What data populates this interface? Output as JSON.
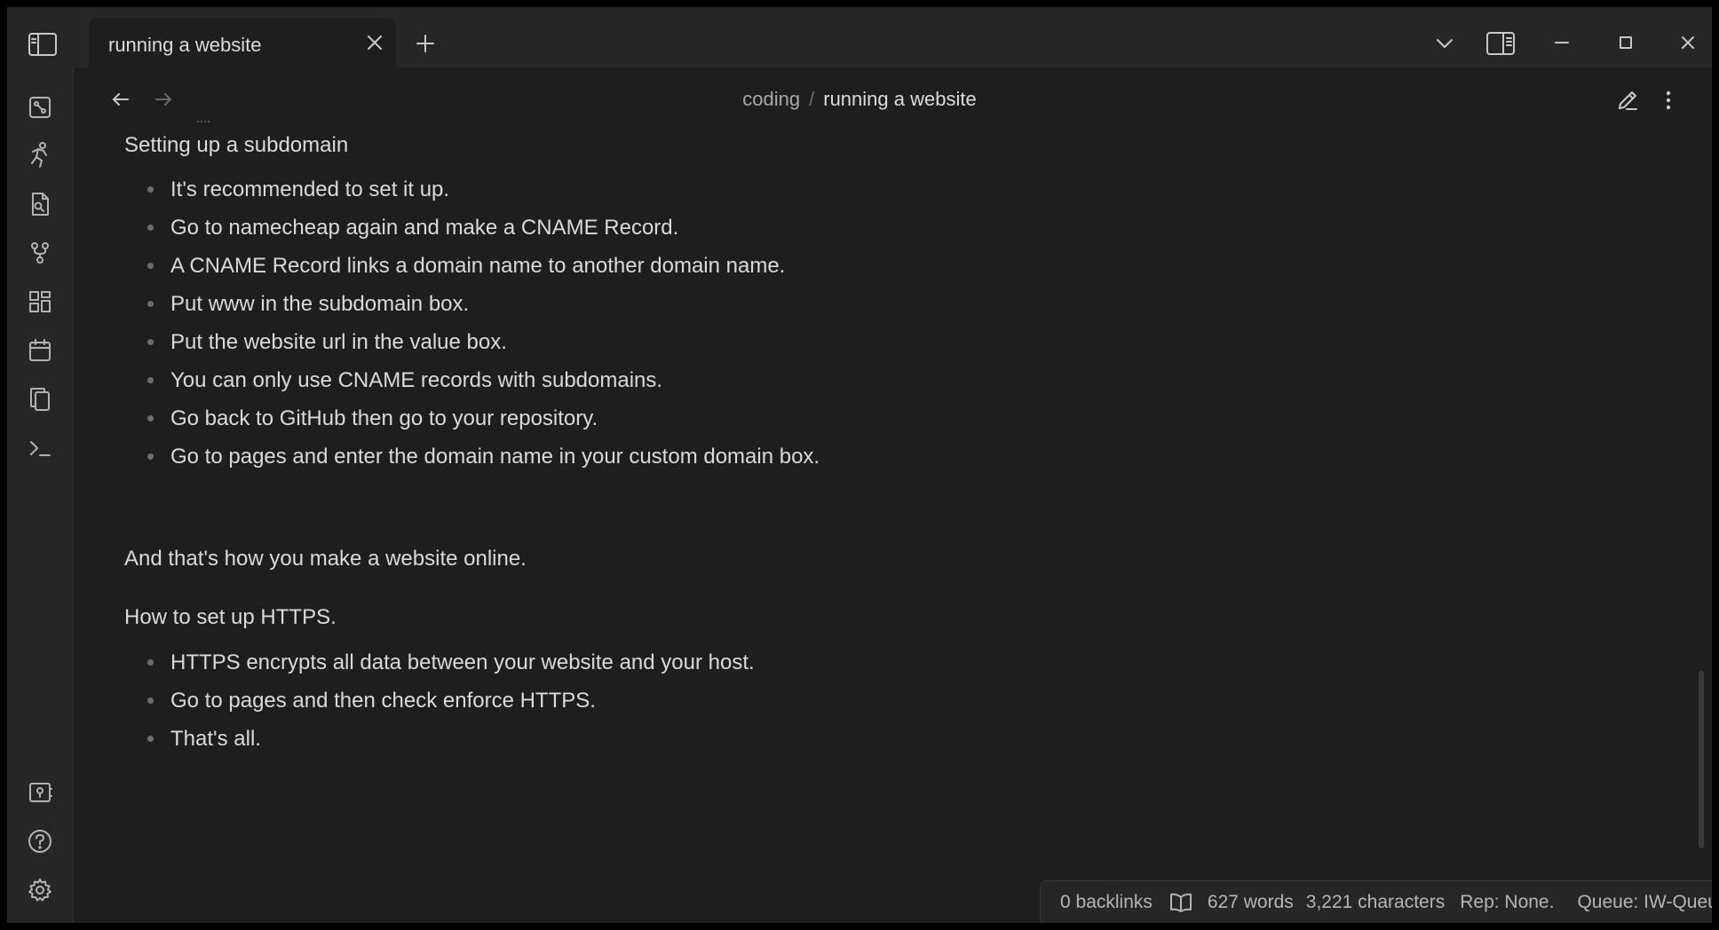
{
  "tab": {
    "title": "running a website"
  },
  "breadcrumb": {
    "folder": "coding",
    "separator": "/",
    "note": "running a website"
  },
  "content": {
    "heading1": "Setting up a subdomain",
    "list1": [
      "It's recommended to set it up.",
      "Go to namecheap again and make a CNAME Record.",
      "A CNAME Record links a domain name to another domain name.",
      "Put www in the subdomain box.",
      "Put the website url in the value box.",
      "You can only use CNAME records with subdomains.",
      "Go back to GitHub then go to your repository.",
      "Go to pages and enter the domain name in your custom domain box."
    ],
    "para2": "And that's how you make a website online.",
    "para3": "How to set up HTTPS.",
    "list2": [
      "HTTPS encrypts all data between your website and your host.",
      "Go to pages and then check enforce HTTPS.",
      "That's all."
    ]
  },
  "status": {
    "backlinks": "0 backlinks",
    "words": "627 words",
    "characters": "3,221 characters",
    "rep": "Rep: None.",
    "queue": "Queue: IW-Queue"
  },
  "icons": {
    "ribbon_top": [
      "graph-view-icon",
      "workout-icon",
      "search-file-icon",
      "git-branch-icon",
      "dashboard-icon",
      "calendar-icon",
      "copy-files-icon",
      "terminal-icon"
    ],
    "ribbon_bottom": [
      "vault-switch-icon",
      "help-icon",
      "settings-icon"
    ]
  },
  "colors": {
    "background": "#1e1e1e",
    "panel": "#262626",
    "text": "#dadada",
    "muted": "#a8a8a8"
  }
}
